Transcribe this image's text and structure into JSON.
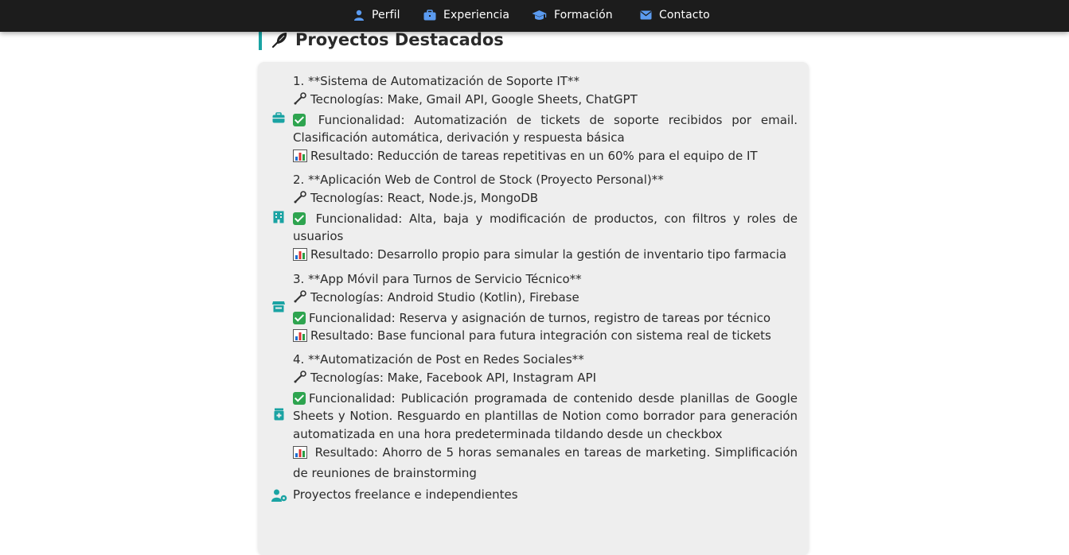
{
  "nav": {
    "items": [
      {
        "label": "Perfil",
        "icon": "user-icon"
      },
      {
        "label": "Experiencia",
        "icon": "briefcase-icon"
      },
      {
        "label": "Formación",
        "icon": "graduation-cap-icon"
      },
      {
        "label": "Contacto",
        "icon": "envelope-icon"
      }
    ]
  },
  "section": {
    "title": "Proyectos Destacados",
    "title_icon": "feather-icon"
  },
  "projects": [
    {
      "icon": "briefcase-icon",
      "title": "1. **Sistema de Automatización de Soporte IT**",
      "tech": "Tecnologías: Make, Gmail API, Google Sheets, ChatGPT",
      "func": " Funcionalidad: Automatización de tickets de soporte recibidos por email. Clasificación automática, derivación y respuesta básica",
      "result": "Resultado: Reducción de tareas repetitivas en un 60% para el equipo de IT"
    },
    {
      "icon": "building-icon",
      "title": "2. **Aplicación Web de Control de Stock (Proyecto Personal)**",
      "tech": "Tecnologías: React, Node.js, MongoDB",
      "func": " Funcionalidad: Alta, baja y modificación de productos, con filtros y roles de usuarios",
      "result": "Resultado: Desarrollo propio para simular la gestión de inventario tipo farmacia"
    },
    {
      "icon": "store-icon",
      "title": "3. **App Móvil para Turnos de Servicio Técnico**",
      "tech": "Tecnologías: Android Studio (Kotlin), Firebase",
      "func": "Funcionalidad: Reserva y asignación de turnos, registro de tareas por técnico",
      "result": "Resultado: Base funcional para futura integración con sistema real de tickets"
    },
    {
      "icon": "medical-bag-icon",
      "title": "4. **Automatización de Post en Redes Sociales**",
      "tech": "Tecnologías: Make, Facebook API, Instagram API",
      "func": "Funcionalidad: Publicación programada de contenido desde planillas de Google Sheets y Notion. Resguardo en plantillas de Notion como borrador para generación automatizada en una hora predeterminada tildando desde un checkbox",
      "result": " Resultado: Ahorro de 5 horas semanales en tareas de marketing. Simplificación de reuniones de brainstorming"
    }
  ],
  "freelance": {
    "icon": "user-gear-icon",
    "label": "Proyectos freelance e independientes"
  },
  "colors": {
    "navbar_bg": "#1c1c1c",
    "accent_teal": "#1aa3a3",
    "nav_icon_blue": "#5b9bf0",
    "card_bg": "#eeeeee"
  }
}
